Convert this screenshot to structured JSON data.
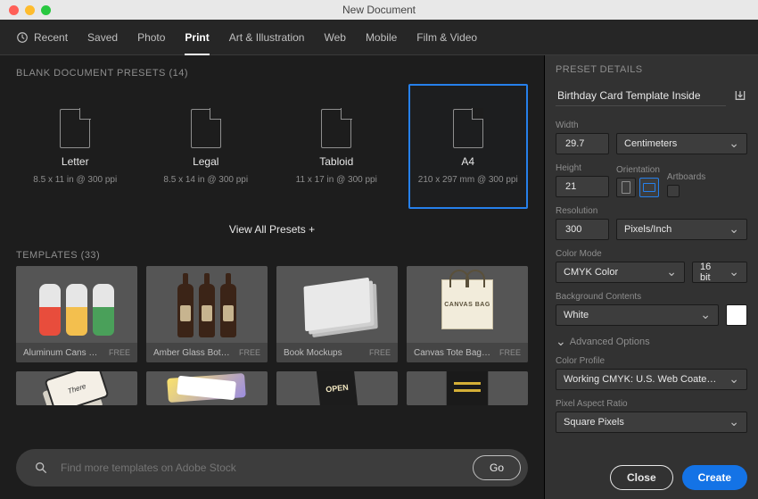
{
  "window": {
    "title": "New Document"
  },
  "tabs": {
    "recent": "Recent",
    "saved": "Saved",
    "photo": "Photo",
    "print": "Print",
    "art": "Art & Illustration",
    "web": "Web",
    "mobile": "Mobile",
    "film": "Film & Video",
    "active": "print"
  },
  "presets_section": {
    "label": "BLANK DOCUMENT PRESETS",
    "count": "(14)",
    "view_all": "View All Presets"
  },
  "presets": [
    {
      "id": "letter",
      "name": "Letter",
      "detail": "8.5 x 11 in @ 300 ppi",
      "selected": false
    },
    {
      "id": "legal",
      "name": "Legal",
      "detail": "8.5 x 14 in @ 300 ppi",
      "selected": false
    },
    {
      "id": "tabloid",
      "name": "Tabloid",
      "detail": "11 x 17 in @ 300 ppi",
      "selected": false
    },
    {
      "id": "a4",
      "name": "A4",
      "detail": "210 x 297 mm @ 300 ppi",
      "selected": true
    }
  ],
  "templates_section": {
    "label": "TEMPLATES",
    "count": "(33)"
  },
  "templates": [
    {
      "name": "Aluminum Cans Moc…",
      "price": "FREE"
    },
    {
      "name": "Amber Glass Bottles…",
      "price": "FREE"
    },
    {
      "name": "Book Mockups",
      "price": "FREE"
    },
    {
      "name": "Canvas Tote Bag Mo…",
      "price": "FREE"
    }
  ],
  "search": {
    "placeholder": "Find more templates on Adobe Stock",
    "go": "Go"
  },
  "details": {
    "title": "PRESET DETAILS",
    "doc_name": "Birthday Card Template Inside",
    "width_label": "Width",
    "width_value": "29.7",
    "units": "Centimeters",
    "height_label": "Height",
    "height_value": "21",
    "orientation_label": "Orientation",
    "artboards_label": "Artboards",
    "resolution_label": "Resolution",
    "resolution_value": "300",
    "resolution_units": "Pixels/Inch",
    "color_mode_label": "Color Mode",
    "color_mode": "CMYK Color",
    "bit_depth": "16 bit",
    "bg_label": "Background Contents",
    "bg_value": "White",
    "bg_swatch": "#ffffff",
    "adv_label": "Advanced Options",
    "color_profile_label": "Color Profile",
    "color_profile": "Working CMYK: U.S. Web Coated (S…",
    "par_label": "Pixel Aspect Ratio",
    "par_value": "Square Pixels"
  },
  "footer": {
    "close": "Close",
    "create": "Create"
  }
}
